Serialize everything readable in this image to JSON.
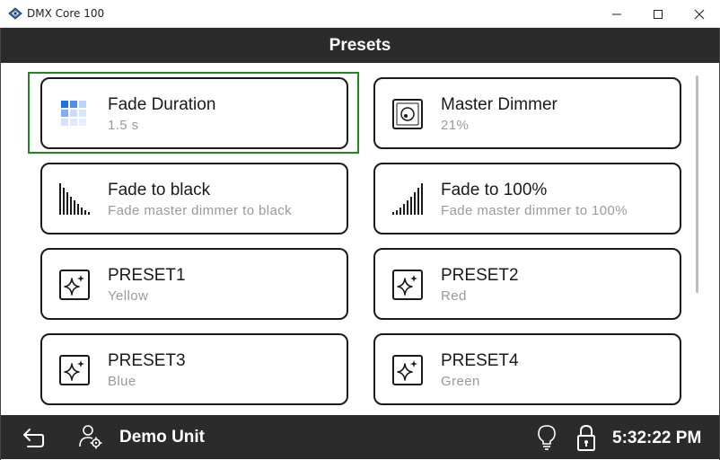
{
  "window": {
    "title": "DMX Core 100",
    "icons": {
      "app": "dmx-core-icon",
      "minimize": "minimize-icon",
      "maximize": "maximize-icon",
      "close": "close-icon"
    }
  },
  "header": {
    "title": "Presets"
  },
  "presets": [
    {
      "title": "Fade Duration",
      "subtitle": "1.5 s",
      "icon": "grid-icon"
    },
    {
      "title": "Master Dimmer",
      "subtitle": "21%",
      "icon": "dimmer-knob-icon"
    },
    {
      "title": "Fade to black",
      "subtitle": "Fade master dimmer to black",
      "icon": "fade-down-bars-icon"
    },
    {
      "title": "Fade to 100%",
      "subtitle": "Fade master dimmer to 100%",
      "icon": "fade-up-bars-icon"
    },
    {
      "title": "PRESET1",
      "subtitle": "Yellow",
      "icon": "sparkle-icon"
    },
    {
      "title": "PRESET2",
      "subtitle": "Red",
      "icon": "sparkle-icon"
    },
    {
      "title": "PRESET3",
      "subtitle": "Blue",
      "icon": "sparkle-icon"
    },
    {
      "title": "PRESET4",
      "subtitle": "Green",
      "icon": "sparkle-icon"
    }
  ],
  "bottom_bar": {
    "unit_name": "Demo Unit",
    "clock": "5:32:22 PM",
    "icons": {
      "back": "back-arrow-icon",
      "user": "user-settings-icon",
      "light": "lightbulb-icon",
      "lock": "lock-icon"
    }
  },
  "colors": {
    "bar": "#2b2b2b",
    "focus": "#1e8a1e",
    "grid_accent": "#1a73e8",
    "card_border": "#1a1a1a"
  }
}
